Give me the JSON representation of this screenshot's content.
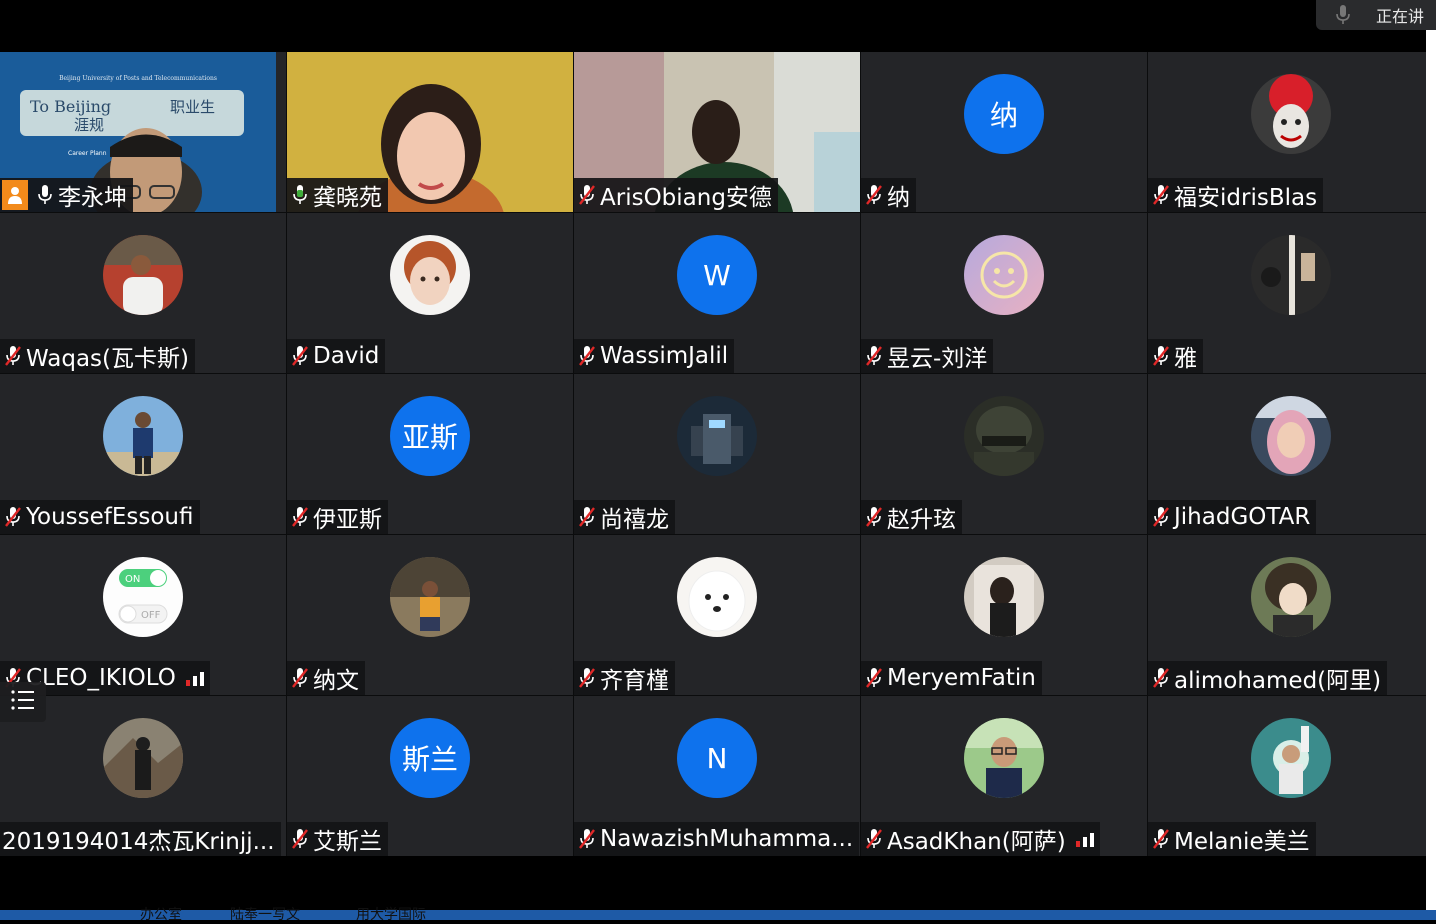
{
  "top": {
    "speaking_label": "正在讲"
  },
  "taskbar": {
    "items": [
      "办公室",
      "陆奉一写文",
      "用大学国际"
    ]
  },
  "video_slide": {
    "line1": "Beijing University of Posts and Telecommunications",
    "line2": "To Beijing",
    "line3": "职业生",
    "line4": "涯规",
    "line5": "Career Plann"
  },
  "participants": [
    {
      "name": "李永坤",
      "mic": "on",
      "video": "slide",
      "host": true
    },
    {
      "name": "龚晓苑",
      "mic": "speaking",
      "video": "yellow",
      "active": true
    },
    {
      "name": "ArisObiang安德",
      "mic": "muted",
      "video": "room"
    },
    {
      "name": "纳",
      "mic": "muted",
      "avatar_text": "纳"
    },
    {
      "name": "福安idrisBlas",
      "mic": "muted",
      "avatar": "clown"
    },
    {
      "name": "Waqas(瓦卡斯)",
      "mic": "muted",
      "avatar": "man-red"
    },
    {
      "name": "David",
      "mic": "muted",
      "avatar": "child"
    },
    {
      "name": "WassimJalil",
      "mic": "muted",
      "avatar_text": "W"
    },
    {
      "name": "昱云-刘洋",
      "mic": "muted",
      "avatar": "smiley"
    },
    {
      "name": "雅",
      "mic": "muted",
      "avatar": "dark-room"
    },
    {
      "name": "YoussefEssoufi",
      "mic": "muted",
      "avatar": "man-blue"
    },
    {
      "name": "伊亚斯",
      "mic": "muted",
      "avatar_text": "亚斯"
    },
    {
      "name": "尚禧龙",
      "mic": "muted",
      "avatar": "robot"
    },
    {
      "name": "赵升玹",
      "mic": "muted",
      "avatar": "helmet"
    },
    {
      "name": "JihadGOTAR",
      "mic": "muted",
      "avatar": "woman-hijab"
    },
    {
      "name": "CLEO_IKIOLO",
      "mic": "muted",
      "avatar": "toggle",
      "signal": true,
      "toggle_on": "ON",
      "toggle_off": "OFF"
    },
    {
      "name": "纳文",
      "mic": "muted",
      "avatar": "man-sitting"
    },
    {
      "name": "齐育槿",
      "mic": "muted",
      "avatar": "dog"
    },
    {
      "name": "MeryemFatin",
      "mic": "muted",
      "avatar": "woman-mirror"
    },
    {
      "name": "alimohamed(阿里)",
      "mic": "muted",
      "avatar": "anime"
    },
    {
      "name": "2019194014杰瓦Krinjj...",
      "mic": "none",
      "avatar": "man-mountain"
    },
    {
      "name": "艾斯兰",
      "mic": "muted",
      "avatar_text": "斯兰"
    },
    {
      "name": "NawazishMuhamma...",
      "mic": "muted",
      "avatar_text": "N"
    },
    {
      "name": "AsadKhan(阿萨)",
      "mic": "muted",
      "avatar": "man-glasses",
      "signal": true
    },
    {
      "name": "Melanie美兰",
      "mic": "muted",
      "avatar": "man-cyan"
    }
  ],
  "colors": {
    "avatar_blue": "#0e72ed",
    "speaking_green": "#3fae3a",
    "muted_red": "#e02828",
    "tile_bg": "#242528"
  }
}
